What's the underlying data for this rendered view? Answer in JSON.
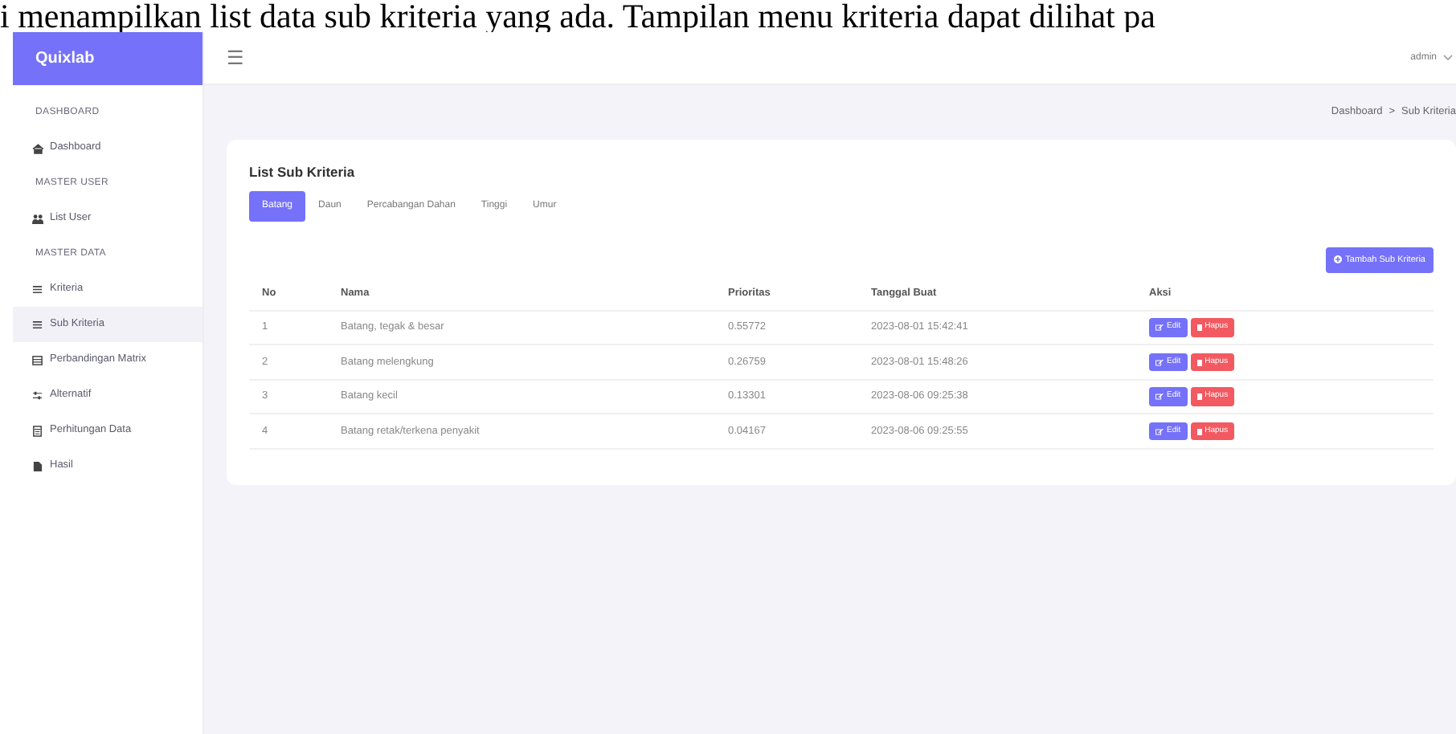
{
  "document_text": "i menampilkan list data sub kriteria yang ada. Tampilan menu kriteria dapat dilihat pa",
  "brand": "Quixlab",
  "header": {
    "menu_glyph": "☰",
    "user": "admin"
  },
  "sidebar": [
    {
      "kind": "heading",
      "label": "DASHBOARD"
    },
    {
      "kind": "item",
      "label": "Dashboard",
      "selected": false
    },
    {
      "kind": "heading",
      "label": "MASTER USER"
    },
    {
      "kind": "item",
      "label": "List User",
      "selected": false
    },
    {
      "kind": "heading",
      "label": "MASTER DATA"
    },
    {
      "kind": "item",
      "label": "Kriteria",
      "selected": false
    },
    {
      "kind": "item",
      "label": "Sub Kriteria",
      "selected": true
    },
    {
      "kind": "item",
      "label": "Perbandingan Matrix",
      "selected": false
    },
    {
      "kind": "item",
      "label": "Alternatif",
      "selected": false
    },
    {
      "kind": "item",
      "label": "Perhitungan Data",
      "selected": false
    },
    {
      "kind": "item",
      "label": "Hasil",
      "selected": false
    }
  ],
  "breadcrumb": [
    "Dashboard",
    "Sub Kriteria"
  ],
  "breadcrumb_sep": ">",
  "card": {
    "title": "List Sub Kriteria",
    "tabs": [
      {
        "label": "Batang",
        "selected": true
      },
      {
        "label": "Daun",
        "selected": false
      },
      {
        "label": "Percabangan Dahan",
        "selected": false
      },
      {
        "label": "Tinggi",
        "selected": false
      },
      {
        "label": "Umur",
        "selected": false
      }
    ],
    "add_button": "Tambah Sub Kriteria",
    "table": {
      "columns": [
        "No",
        "Nama",
        "Prioritas",
        "Tanggal Buat",
        "Aksi"
      ],
      "rows": [
        {
          "no": "1",
          "nama": "Batang, tegak & besar",
          "prioritas": "0.55772",
          "tanggal": "2023-08-01 15:42:41",
          "edit": "Edit",
          "hapus": "Hapus"
        },
        {
          "no": "2",
          "nama": "Batang melengkung",
          "prioritas": "0.26759",
          "tanggal": "2023-08-01 15:48:26",
          "edit": "Edit",
          "hapus": "Hapus"
        },
        {
          "no": "3",
          "nama": "Batang kecil",
          "prioritas": "0.13301",
          "tanggal": "2023-08-06 09:25:38",
          "edit": "Edit",
          "hapus": "Hapus"
        },
        {
          "no": "4",
          "nama": "Batang retak/terkena penyakit",
          "prioritas": "0.04167",
          "tanggal": "2023-08-06 09:25:55",
          "edit": "Edit",
          "hapus": "Hapus"
        }
      ]
    }
  }
}
